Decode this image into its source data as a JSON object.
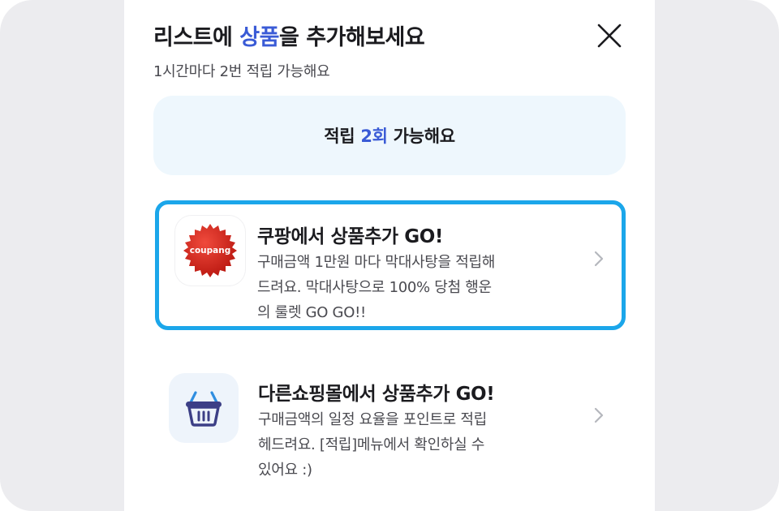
{
  "modal": {
    "title_prefix": "리스트에 ",
    "title_highlight": "상품",
    "title_suffix": "을 추가해보세요",
    "subtitle": "1시간마다 2번 적립 가능해요",
    "close_icon": "close-icon"
  },
  "banner": {
    "prefix": "적립 ",
    "count": "2회",
    "suffix": " 가능해요"
  },
  "options": [
    {
      "title": "쿠팡에서 상품추가 GO!",
      "logo_text": "coupang",
      "desc_lines": [
        "구매금액 1만원 마다 막대사탕을 적립해",
        "드려요. 막대사탕으로 100% 당첨 행운",
        "의 룰렛 GO GO!!"
      ],
      "icon": "coupang-logo-icon",
      "selected": true
    },
    {
      "title": "다른쇼핑몰에서 상품추가 GO!",
      "desc_lines": [
        "구매금액의 일정 요율을 포인트로 적립",
        "헤드려요. [적립]메뉴에서 확인하실 수",
        "있어요 :)"
      ],
      "icon": "shopping-basket-icon",
      "selected": false
    }
  ],
  "colors": {
    "accent_blue": "#3a5bd6",
    "selected_border": "#1ba6ea",
    "banner_bg": "#eef7fd",
    "coupang_red": "#d9231c"
  }
}
